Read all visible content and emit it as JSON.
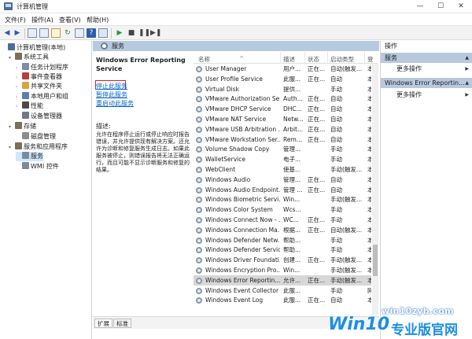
{
  "window": {
    "title": "计算机管理",
    "minimize": "—",
    "maximize": "☐",
    "close": "✕"
  },
  "menu": [
    "文件(F)",
    "操作(A)",
    "查看(V)",
    "帮助(H)"
  ],
  "tree": [
    {
      "label": "计算机管理(本地)",
      "indent": 0,
      "arrow": "",
      "color": "#4a6d9c"
    },
    {
      "label": "系统工具",
      "indent": 1,
      "arrow": "▾",
      "color": "#7a6e55"
    },
    {
      "label": "任务计划程序",
      "indent": 2,
      "arrow": "›",
      "color": "#7c8fa8"
    },
    {
      "label": "事件查看器",
      "indent": 2,
      "arrow": "›",
      "color": "#b34040"
    },
    {
      "label": "共享文件夹",
      "indent": 2,
      "arrow": "›",
      "color": "#d9a441"
    },
    {
      "label": "本地用户和组",
      "indent": 2,
      "arrow": "›",
      "color": "#5d7fb0"
    },
    {
      "label": "性能",
      "indent": 2,
      "arrow": "›",
      "color": "#4a4a4a"
    },
    {
      "label": "设备管理器",
      "indent": 2,
      "arrow": "",
      "color": "#6c7a89"
    },
    {
      "label": "存储",
      "indent": 1,
      "arrow": "▾",
      "color": "#7a6e55"
    },
    {
      "label": "磁盘管理",
      "indent": 2,
      "arrow": "",
      "color": "#8c8c8c"
    },
    {
      "label": "服务和应用程序",
      "indent": 1,
      "arrow": "▾",
      "color": "#7a6e55"
    },
    {
      "label": "服务",
      "indent": 2,
      "arrow": "",
      "color": "#7d8b99",
      "selected": true
    },
    {
      "label": "WMI 控件",
      "indent": 2,
      "arrow": "",
      "color": "#7d8b99"
    }
  ],
  "services_header": "服务",
  "desc": {
    "title": "Windows Error Reporting Service",
    "stop_link": "停止此服务",
    "pause_link": "暂停此服务",
    "restart_link": "重启动此服务",
    "label": "描述:",
    "text": "允许在程序停止运行或停止响应时报告错误，并允许提供现有解决方案。还允许为诊断和修复服务生成日志。如果此服务被停止，则错误报告将无法正确运行，而且可能不显示诊断服务和修复的结果。"
  },
  "columns": [
    "名称",
    "描述",
    "状态",
    "启动类型",
    "登"
  ],
  "sort_arrow": "^",
  "rows": [
    {
      "name": "User Manager",
      "desc": "用户...",
      "status": "正在...",
      "startup": "自动(触发...",
      "logon": "本"
    },
    {
      "name": "User Profile Service",
      "desc": "此服...",
      "status": "正在...",
      "startup": "自动",
      "logon": "本"
    },
    {
      "name": "Virtual Disk",
      "desc": "提供...",
      "status": "",
      "startup": "手动",
      "logon": "本"
    },
    {
      "name": "VMware Authorization Se...",
      "desc": "Auth...",
      "status": "正在...",
      "startup": "自动",
      "logon": "本"
    },
    {
      "name": "VMware DHCP Service",
      "desc": "DHC...",
      "status": "正在...",
      "startup": "自动",
      "logon": "本"
    },
    {
      "name": "VMware NAT Service",
      "desc": "Netw...",
      "status": "正在...",
      "startup": "自动",
      "logon": "本"
    },
    {
      "name": "VMware USB Arbitration ...",
      "desc": "Arbit...",
      "status": "正在...",
      "startup": "自动",
      "logon": "本"
    },
    {
      "name": "VMware Workstation Ser...",
      "desc": "Rem...",
      "status": "正在...",
      "startup": "自动",
      "logon": "本"
    },
    {
      "name": "Volume Shadow Copy",
      "desc": "管理...",
      "status": "",
      "startup": "手动",
      "logon": "本"
    },
    {
      "name": "WalletService",
      "desc": "电子...",
      "status": "",
      "startup": "手动",
      "logon": "本"
    },
    {
      "name": "WebClient",
      "desc": "使基...",
      "status": "",
      "startup": "手动(触发...",
      "logon": "本"
    },
    {
      "name": "Windows Audio",
      "desc": "管理...",
      "status": "正在...",
      "startup": "自动",
      "logon": "本"
    },
    {
      "name": "Windows Audio Endpoint...",
      "desc": "管理 ...",
      "status": "正在...",
      "startup": "自动",
      "logon": "本"
    },
    {
      "name": "Windows Biometric Servi...",
      "desc": "Win...",
      "status": "",
      "startup": "手动(触发...",
      "logon": "本"
    },
    {
      "name": "Windows Color System",
      "desc": "Wcs...",
      "status": "",
      "startup": "手动",
      "logon": "本"
    },
    {
      "name": "Windows Connect Now - ...",
      "desc": "WC...",
      "status": "正在...",
      "startup": "手动",
      "logon": "本"
    },
    {
      "name": "Windows Connection Ma...",
      "desc": "根据...",
      "status": "正在...",
      "startup": "自动(触发...",
      "logon": "本"
    },
    {
      "name": "Windows Defender Netw...",
      "desc": "帮助...",
      "status": "",
      "startup": "手动",
      "logon": "本"
    },
    {
      "name": "Windows Defender Service",
      "desc": "帮助...",
      "status": "",
      "startup": "手动",
      "logon": "本"
    },
    {
      "name": "Windows Driver Foundati...",
      "desc": "创建...",
      "status": "正在...",
      "startup": "手动(触发...",
      "logon": "本"
    },
    {
      "name": "Windows Encryption Pro...",
      "desc": "Win...",
      "status": "",
      "startup": "手动(触发...",
      "logon": "本"
    },
    {
      "name": "Windows Error Reportin...",
      "desc": "允许...",
      "status": "正在...",
      "startup": "手动(触发...",
      "logon": "本",
      "selected": true
    },
    {
      "name": "Windows Event Collector",
      "desc": "此服...",
      "status": "",
      "startup": "手动",
      "logon": "网"
    },
    {
      "name": "Windows Event Log",
      "desc": "此服...",
      "status": "正在...",
      "startup": "自动",
      "logon": "本"
    }
  ],
  "tabs": [
    "扩展",
    "标准"
  ],
  "actions": {
    "title": "操作",
    "group1": "服务",
    "more1": "更多操作",
    "group2": "Windows Error Reportin...",
    "more2": "更多操作"
  },
  "watermark": {
    "url": "win10zyb.com",
    "brand_a": "Win10",
    "brand_b": "专业版官网"
  }
}
